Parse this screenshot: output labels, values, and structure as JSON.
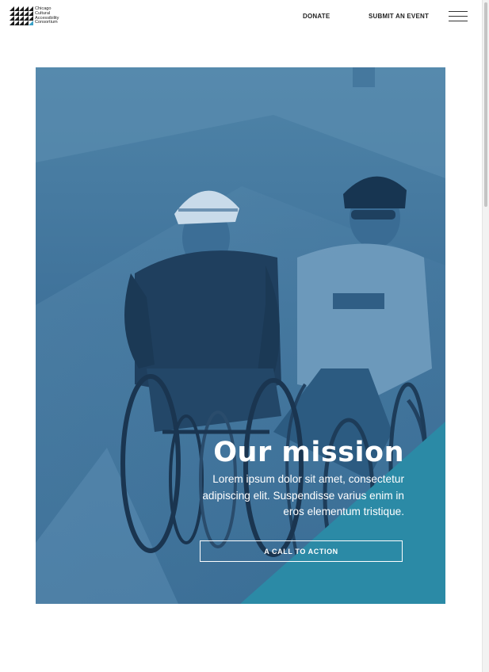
{
  "header": {
    "logo_lines": [
      "Chicago",
      "Cultural",
      "Accessibility",
      "Consortium"
    ],
    "nav": {
      "donate_label": "DONATE",
      "submit_label": "SUBMIT AN EVENT"
    },
    "menu_icon": "hamburger-menu-icon"
  },
  "hero": {
    "image_subject": "two wheelchair racers on a road",
    "overlay_color": "#4a7fa4",
    "accent_color": "#2b8aa6",
    "title": "Our mission",
    "body": "Lorem ipsum dolor sit amet, consectetur adipiscing elit. Suspendisse varius enim in eros elementum tristique.",
    "cta_label": "A CALL TO ACTION"
  },
  "colors": {
    "text": "#222222",
    "white": "#ffffff"
  }
}
